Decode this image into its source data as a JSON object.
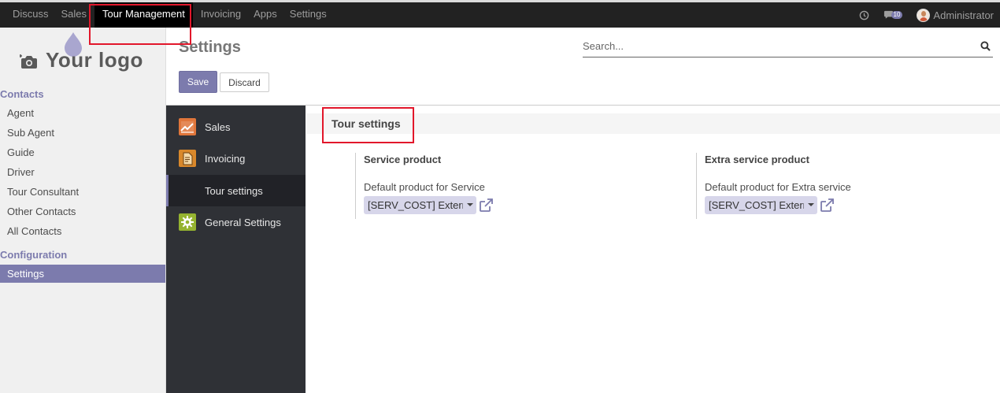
{
  "topbar": {
    "menu": [
      "Discuss",
      "Sales",
      "Tour Management",
      "Invoicing",
      "Apps",
      "Settings"
    ],
    "active_menu": "Tour Management",
    "messages_count": "10",
    "user": "Administrator"
  },
  "sidebar": {
    "logo_text": "Your logo",
    "contacts_heading": "Contacts",
    "contacts_items": [
      "Agent",
      "Sub Agent",
      "Guide",
      "Driver",
      "Tour Consultant",
      "Other Contacts",
      "All Contacts"
    ],
    "configuration_heading": "Configuration",
    "configuration_items": [
      "Settings"
    ]
  },
  "control": {
    "title": "Settings",
    "search_placeholder": "Search...",
    "save_label": "Save",
    "discard_label": "Discard"
  },
  "app_menu": [
    {
      "label": "Sales",
      "icon": "sales-chart-icon"
    },
    {
      "label": "Invoicing",
      "icon": "invoice-icon"
    },
    {
      "label": "Tour settings",
      "icon": ""
    },
    {
      "label": "General Settings",
      "icon": "gear-icon"
    }
  ],
  "content": {
    "block_title": "Tour settings",
    "settings": [
      {
        "title": "Service product",
        "description": "Default product for Service",
        "value": "[SERV_COST] External Service"
      },
      {
        "title": "Extra service product",
        "description": "Default product for Extra service",
        "value": "[SERV_COST] External Service"
      }
    ]
  },
  "colors": {
    "accent": "#7c7bad",
    "navbar": "#222222",
    "app_sidebar": "#2f3136",
    "highlight_box": "#e2172b"
  }
}
